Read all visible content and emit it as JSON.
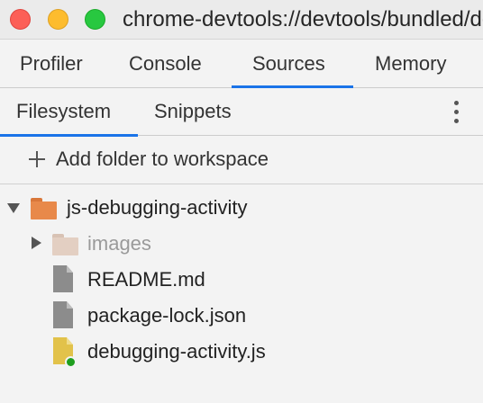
{
  "window": {
    "title": "chrome-devtools://devtools/bundled/devtools_app.html"
  },
  "tabs": [
    {
      "label": "Profiler",
      "selected": false
    },
    {
      "label": "Console",
      "selected": false
    },
    {
      "label": "Sources",
      "selected": true
    },
    {
      "label": "Memory",
      "selected": false
    }
  ],
  "subtabs": [
    {
      "label": "Filesystem",
      "selected": true
    },
    {
      "label": "Snippets",
      "selected": false
    }
  ],
  "actions": {
    "add_folder_label": "Add folder to workspace"
  },
  "tree": {
    "root": {
      "label": "js-debugging-activity",
      "icon": "folder-icon",
      "expanded": true
    },
    "items": [
      {
        "label": "images",
        "icon": "folder-icon",
        "expanded": false
      },
      {
        "label": "README.md",
        "icon": "file-icon"
      },
      {
        "label": "package-lock.json",
        "icon": "file-icon"
      },
      {
        "label": "debugging-activity.js",
        "icon": "js-file-icon",
        "status": "mapped"
      }
    ]
  },
  "colors": {
    "accent": "#1a73e8",
    "folder": "#e8894a",
    "js_file": "#e2c24a",
    "mapped_dot": "#1e9e1e"
  }
}
